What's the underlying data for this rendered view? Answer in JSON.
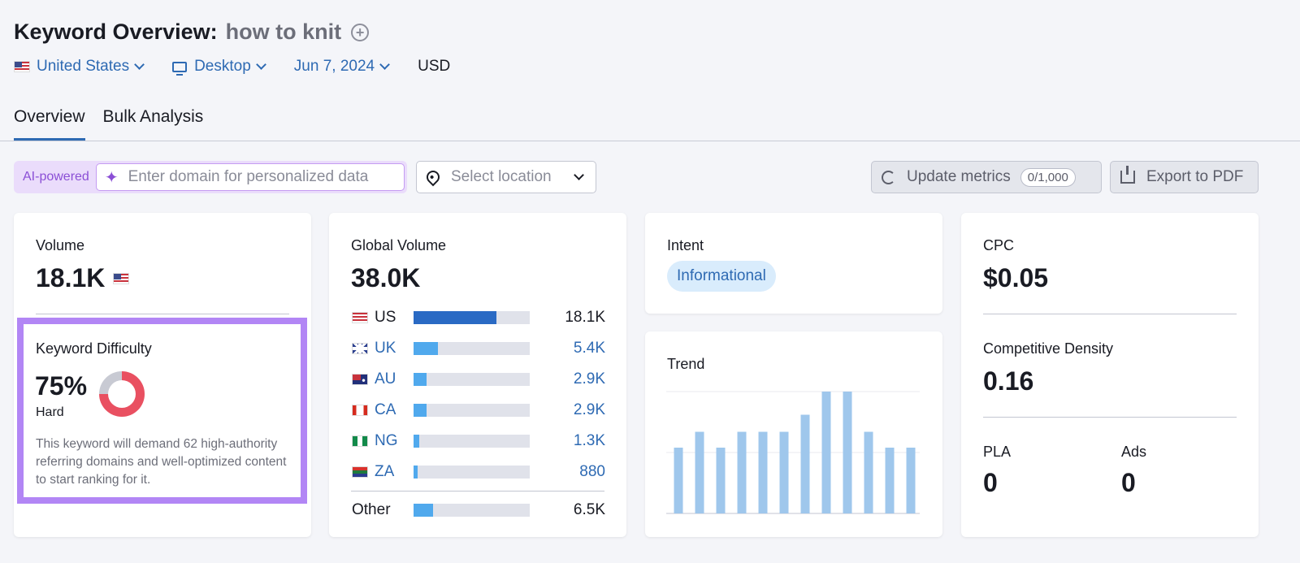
{
  "header": {
    "title": "Keyword Overview:",
    "keyword": "how to knit",
    "filters": {
      "country": "United States",
      "device": "Desktop",
      "date": "Jun 7, 2024",
      "currency": "USD"
    }
  },
  "tabs": [
    {
      "label": "Overview",
      "active": true
    },
    {
      "label": "Bulk Analysis",
      "active": false
    }
  ],
  "toolbar": {
    "ai_label": "AI-powered",
    "domain_placeholder": "Enter domain for personalized data",
    "location_placeholder": "Select location",
    "update_label": "Update metrics",
    "update_count": "0/1,000",
    "export_label": "Export to PDF"
  },
  "volume": {
    "label": "Volume",
    "value": "18.1K"
  },
  "kd": {
    "label": "Keyword Difficulty",
    "value": "75%",
    "percent": 75,
    "level": "Hard",
    "description": "This keyword will demand 62 high-authority referring domains and well-optimized content to start ranking for it."
  },
  "global_volume": {
    "label": "Global Volume",
    "value": "38.0K",
    "countries": [
      {
        "code": "US",
        "value": "18.1K",
        "share": 0.476,
        "color": "#2a6ac4",
        "link": false
      },
      {
        "code": "UK",
        "value": "5.4K",
        "share": 0.142,
        "color": "#50a9ed",
        "link": true
      },
      {
        "code": "AU",
        "value": "2.9K",
        "share": 0.076,
        "color": "#50a9ed",
        "link": true
      },
      {
        "code": "CA",
        "value": "2.9K",
        "share": 0.076,
        "color": "#50a9ed",
        "link": true
      },
      {
        "code": "NG",
        "value": "1.3K",
        "share": 0.034,
        "color": "#50a9ed",
        "link": true
      },
      {
        "code": "ZA",
        "value": "880",
        "share": 0.023,
        "color": "#50a9ed",
        "link": true
      }
    ],
    "other": {
      "label": "Other",
      "value": "6.5K",
      "share": 0.171
    }
  },
  "intent": {
    "label": "Intent",
    "value": "Informational"
  },
  "trend": {
    "label": "Trend",
    "values": [
      0.54,
      0.67,
      0.54,
      0.67,
      0.67,
      0.67,
      0.81,
      1.0,
      1.0,
      0.67,
      0.54,
      0.54
    ]
  },
  "cpc": {
    "label": "CPC",
    "value": "$0.05"
  },
  "competitive_density": {
    "label": "Competitive Density",
    "value": "0.16"
  },
  "pla": {
    "label": "PLA",
    "value": "0"
  },
  "ads": {
    "label": "Ads",
    "value": "0"
  },
  "colors": {
    "link_blue": "#2e6ab3",
    "accent_purple": "#b286f5",
    "kd_red": "#e95061",
    "trend_bar": "#9fc7ec"
  }
}
